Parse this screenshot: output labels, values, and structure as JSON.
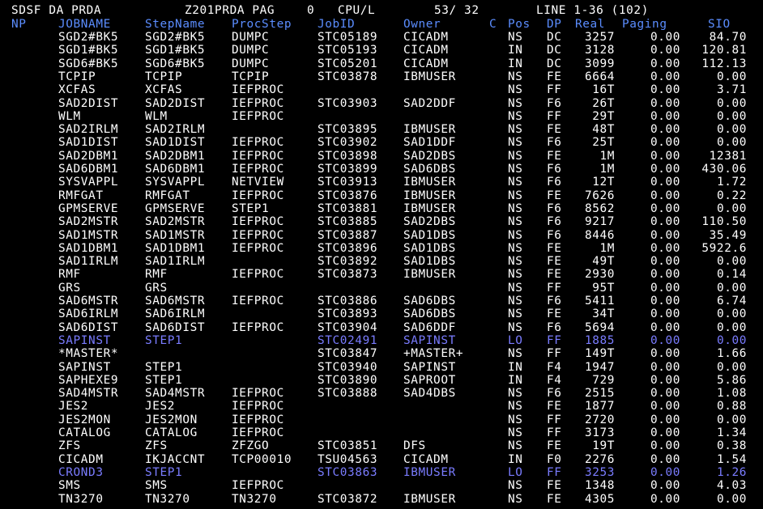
{
  "title_bar": {
    "panel": "SDSF DA PRDA",
    "system": "Z201PRDA PAG",
    "pag": "0",
    "cpu_label": "CPU/L",
    "cpu": "53/ 32",
    "line_info": "LINE 1-36 (102)"
  },
  "columns": [
    "NP",
    "JOBNAME",
    "StepName",
    "ProcStep",
    "JobID",
    "Owner",
    "C",
    "Pos",
    "DP",
    "Real",
    "Paging",
    "SIO"
  ],
  "colors": {
    "normal": "#ffffff",
    "header": "#5b8dff",
    "highlight": "#7a7cff",
    "background": "#000000"
  },
  "rows": [
    {
      "job": "SGD2#BK5",
      "step": "SGD2#BK5",
      "proc": "DUMPC",
      "jobid": "STC05189",
      "owner": "CICADM",
      "pos": "NS",
      "dp": "DC",
      "real": "3257",
      "paging": "0.00",
      "sio": "84.70",
      "hl": false
    },
    {
      "job": "SGD1#BK5",
      "step": "SGD1#BK5",
      "proc": "DUMPC",
      "jobid": "STC05193",
      "owner": "CICADM",
      "pos": "IN",
      "dp": "DC",
      "real": "3128",
      "paging": "0.00",
      "sio": "120.81",
      "hl": false
    },
    {
      "job": "SGD6#BK5",
      "step": "SGD6#BK5",
      "proc": "DUMPC",
      "jobid": "STC05201",
      "owner": "CICADM",
      "pos": "IN",
      "dp": "DC",
      "real": "3099",
      "paging": "0.00",
      "sio": "112.13",
      "hl": false
    },
    {
      "job": "TCPIP",
      "step": "TCPIP",
      "proc": "TCPIP",
      "jobid": "STC03878",
      "owner": "IBMUSER",
      "pos": "NS",
      "dp": "FE",
      "real": "6664",
      "paging": "0.00",
      "sio": "0.00",
      "hl": false
    },
    {
      "job": "XCFAS",
      "step": "XCFAS",
      "proc": "IEFPROC",
      "jobid": "",
      "owner": "",
      "pos": "NS",
      "dp": "FF",
      "real": "16T",
      "paging": "0.00",
      "sio": "3.71",
      "hl": false
    },
    {
      "job": "SAD2DIST",
      "step": "SAD2DIST",
      "proc": "IEFPROC",
      "jobid": "STC03903",
      "owner": "SAD2DDF",
      "pos": "NS",
      "dp": "F6",
      "real": "26T",
      "paging": "0.00",
      "sio": "0.00",
      "hl": false
    },
    {
      "job": "WLM",
      "step": "WLM",
      "proc": "IEFPROC",
      "jobid": "",
      "owner": "",
      "pos": "NS",
      "dp": "FF",
      "real": "29T",
      "paging": "0.00",
      "sio": "0.00",
      "hl": false
    },
    {
      "job": "SAD2IRLM",
      "step": "SAD2IRLM",
      "proc": "",
      "jobid": "STC03895",
      "owner": "IBMUSER",
      "pos": "NS",
      "dp": "FE",
      "real": "48T",
      "paging": "0.00",
      "sio": "0.00",
      "hl": false
    },
    {
      "job": "SAD1DIST",
      "step": "SAD1DIST",
      "proc": "IEFPROC",
      "jobid": "STC03902",
      "owner": "SAD1DDF",
      "pos": "NS",
      "dp": "F6",
      "real": "25T",
      "paging": "0.00",
      "sio": "0.00",
      "hl": false
    },
    {
      "job": "SAD2DBM1",
      "step": "SAD2DBM1",
      "proc": "IEFPROC",
      "jobid": "STC03898",
      "owner": "SAD2DBS",
      "pos": "NS",
      "dp": "FE",
      "real": "1M",
      "paging": "0.00",
      "sio": "12381",
      "hl": false
    },
    {
      "job": "SAD6DBM1",
      "step": "SAD6DBM1",
      "proc": "IEFPROC",
      "jobid": "STC03899",
      "owner": "SAD6DBS",
      "pos": "NS",
      "dp": "F6",
      "real": "1M",
      "paging": "0.00",
      "sio": "430.06",
      "hl": false
    },
    {
      "job": "SYSVAPPL",
      "step": "SYSVAPPL",
      "proc": "NETVIEW",
      "jobid": "STC03913",
      "owner": "IBMUSER",
      "pos": "NS",
      "dp": "F6",
      "real": "12T",
      "paging": "0.00",
      "sio": "1.72",
      "hl": false
    },
    {
      "job": "RMFGAT",
      "step": "RMFGAT",
      "proc": "IEFPROC",
      "jobid": "STC03876",
      "owner": "IBMUSER",
      "pos": "NS",
      "dp": "FE",
      "real": "7626",
      "paging": "0.00",
      "sio": "0.22",
      "hl": false
    },
    {
      "job": "GPMSERVE",
      "step": "GPMSERVE",
      "proc": "STEP1",
      "jobid": "STC03881",
      "owner": "IBMUSER",
      "pos": "NS",
      "dp": "F6",
      "real": "8562",
      "paging": "0.00",
      "sio": "0.00",
      "hl": false
    },
    {
      "job": "SAD2MSTR",
      "step": "SAD2MSTR",
      "proc": "IEFPROC",
      "jobid": "STC03885",
      "owner": "SAD2DBS",
      "pos": "NS",
      "dp": "F6",
      "real": "9217",
      "paging": "0.00",
      "sio": "110.50",
      "hl": false
    },
    {
      "job": "SAD1MSTR",
      "step": "SAD1MSTR",
      "proc": "IEFPROC",
      "jobid": "STC03887",
      "owner": "SAD1DBS",
      "pos": "NS",
      "dp": "F6",
      "real": "8446",
      "paging": "0.00",
      "sio": "35.49",
      "hl": false
    },
    {
      "job": "SAD1DBM1",
      "step": "SAD1DBM1",
      "proc": "IEFPROC",
      "jobid": "STC03896",
      "owner": "SAD1DBS",
      "pos": "NS",
      "dp": "FE",
      "real": "1M",
      "paging": "0.00",
      "sio": "5922.6",
      "hl": false
    },
    {
      "job": "SAD1IRLM",
      "step": "SAD1IRLM",
      "proc": "",
      "jobid": "STC03892",
      "owner": "SAD1DBS",
      "pos": "NS",
      "dp": "FE",
      "real": "49T",
      "paging": "0.00",
      "sio": "0.00",
      "hl": false
    },
    {
      "job": "RMF",
      "step": "RMF",
      "proc": "IEFPROC",
      "jobid": "STC03873",
      "owner": "IBMUSER",
      "pos": "NS",
      "dp": "FE",
      "real": "2930",
      "paging": "0.00",
      "sio": "0.14",
      "hl": false
    },
    {
      "job": "GRS",
      "step": "GRS",
      "proc": "",
      "jobid": "",
      "owner": "",
      "pos": "NS",
      "dp": "FF",
      "real": "95T",
      "paging": "0.00",
      "sio": "0.00",
      "hl": false
    },
    {
      "job": "SAD6MSTR",
      "step": "SAD6MSTR",
      "proc": "IEFPROC",
      "jobid": "STC03886",
      "owner": "SAD6DBS",
      "pos": "NS",
      "dp": "F6",
      "real": "5411",
      "paging": "0.00",
      "sio": "6.74",
      "hl": false
    },
    {
      "job": "SAD6IRLM",
      "step": "SAD6IRLM",
      "proc": "",
      "jobid": "STC03893",
      "owner": "SAD6DBS",
      "pos": "NS",
      "dp": "FE",
      "real": "34T",
      "paging": "0.00",
      "sio": "0.00",
      "hl": false
    },
    {
      "job": "SAD6DIST",
      "step": "SAD6DIST",
      "proc": "IEFPROC",
      "jobid": "STC03904",
      "owner": "SAD6DDF",
      "pos": "NS",
      "dp": "F6",
      "real": "5694",
      "paging": "0.00",
      "sio": "0.00",
      "hl": false
    },
    {
      "job": "SAPINST",
      "step": "STEP1",
      "proc": "",
      "jobid": "STC02491",
      "owner": "SAPINST",
      "pos": "LO",
      "dp": "FF",
      "real": "1885",
      "paging": "0.00",
      "sio": "0.00",
      "hl": true
    },
    {
      "job": "*MASTER*",
      "step": "",
      "proc": "",
      "jobid": "STC03847",
      "owner": "+MASTER+",
      "pos": "NS",
      "dp": "FF",
      "real": "149T",
      "paging": "0.00",
      "sio": "1.66",
      "hl": false
    },
    {
      "job": "SAPINST",
      "step": "STEP1",
      "proc": "",
      "jobid": "STC03940",
      "owner": "SAPINST",
      "pos": "IN",
      "dp": "F4",
      "real": "1947",
      "paging": "0.00",
      "sio": "0.00",
      "hl": false
    },
    {
      "job": "SAPHEXE9",
      "step": "STEP1",
      "proc": "",
      "jobid": "STC03890",
      "owner": "SAPROOT",
      "pos": "IN",
      "dp": "F4",
      "real": "729",
      "paging": "0.00",
      "sio": "5.86",
      "hl": false
    },
    {
      "job": "SAD4MSTR",
      "step": "SAD4MSTR",
      "proc": "IEFPROC",
      "jobid": "STC03888",
      "owner": "SAD4DBS",
      "pos": "NS",
      "dp": "F6",
      "real": "2515",
      "paging": "0.00",
      "sio": "1.08",
      "hl": false
    },
    {
      "job": "JES2",
      "step": "JES2",
      "proc": "IEFPROC",
      "jobid": "",
      "owner": "",
      "pos": "NS",
      "dp": "FE",
      "real": "1877",
      "paging": "0.00",
      "sio": "0.88",
      "hl": false
    },
    {
      "job": "JES2MON",
      "step": "JES2MON",
      "proc": "IEFPROC",
      "jobid": "",
      "owner": "",
      "pos": "NS",
      "dp": "FF",
      "real": "2720",
      "paging": "0.00",
      "sio": "0.00",
      "hl": false
    },
    {
      "job": "CATALOG",
      "step": "CATALOG",
      "proc": "IEFPROC",
      "jobid": "",
      "owner": "",
      "pos": "NS",
      "dp": "FF",
      "real": "3173",
      "paging": "0.00",
      "sio": "1.34",
      "hl": false
    },
    {
      "job": "ZFS",
      "step": "ZFS",
      "proc": "ZFZGO",
      "jobid": "STC03851",
      "owner": "DFS",
      "pos": "NS",
      "dp": "FE",
      "real": "19T",
      "paging": "0.00",
      "sio": "0.38",
      "hl": false
    },
    {
      "job": "CICADM",
      "step": "IKJACCNT",
      "proc": "TCP00010",
      "jobid": "TSU04563",
      "owner": "CICADM",
      "pos": "IN",
      "dp": "F0",
      "real": "2276",
      "paging": "0.00",
      "sio": "1.54",
      "hl": false
    },
    {
      "job": "CROND3",
      "step": "STEP1",
      "proc": "",
      "jobid": "STC03863",
      "owner": "IBMUSER",
      "pos": "LO",
      "dp": "FF",
      "real": "3253",
      "paging": "0.00",
      "sio": "1.26",
      "hl": true
    },
    {
      "job": "SMS",
      "step": "SMS",
      "proc": "IEFPROC",
      "jobid": "",
      "owner": "",
      "pos": "NS",
      "dp": "FE",
      "real": "1348",
      "paging": "0.00",
      "sio": "4.03",
      "hl": false
    },
    {
      "job": "TN3270",
      "step": "TN3270",
      "proc": "TN3270",
      "jobid": "STC03872",
      "owner": "IBMUSER",
      "pos": "NS",
      "dp": "FE",
      "real": "4305",
      "paging": "0.00",
      "sio": "0.00",
      "hl": false
    }
  ]
}
